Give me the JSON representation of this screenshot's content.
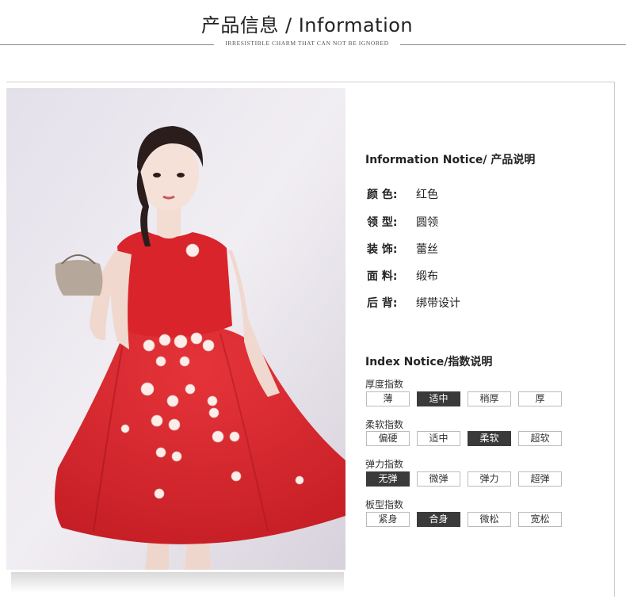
{
  "header": {
    "title": "产品信息 / Information",
    "subtitle": "IRRESISTIBLE CHARM THAT CAN NOT BE IGNORED"
  },
  "info": {
    "title": "Information Notice/ 产品说明",
    "rows": [
      {
        "label": "颜 色:",
        "value": "红色"
      },
      {
        "label": "领 型:",
        "value": "圆领"
      },
      {
        "label": "装 饰:",
        "value": "蕾丝"
      },
      {
        "label": "面 料:",
        "value": "缎布"
      },
      {
        "label": "后 背:",
        "value": "绑带设计"
      }
    ]
  },
  "index": {
    "title": "Index Notice/指数说明",
    "groups": [
      {
        "label": "厚度指数",
        "options": [
          "薄",
          "适中",
          "稍厚",
          "厚"
        ],
        "selected": 1
      },
      {
        "label": "柔软指数",
        "options": [
          "偏硬",
          "适中",
          "柔软",
          "超软"
        ],
        "selected": 2
      },
      {
        "label": "弹力指数",
        "options": [
          "无弹",
          "微弹",
          "弹力",
          "超弹"
        ],
        "selected": 0
      },
      {
        "label": "板型指数",
        "options": [
          "紧身",
          "合身",
          "微松",
          "宽松"
        ],
        "selected": 1
      }
    ]
  },
  "colors": {
    "dress": "#d9262b",
    "selected_bg": "#3a3a3a"
  }
}
